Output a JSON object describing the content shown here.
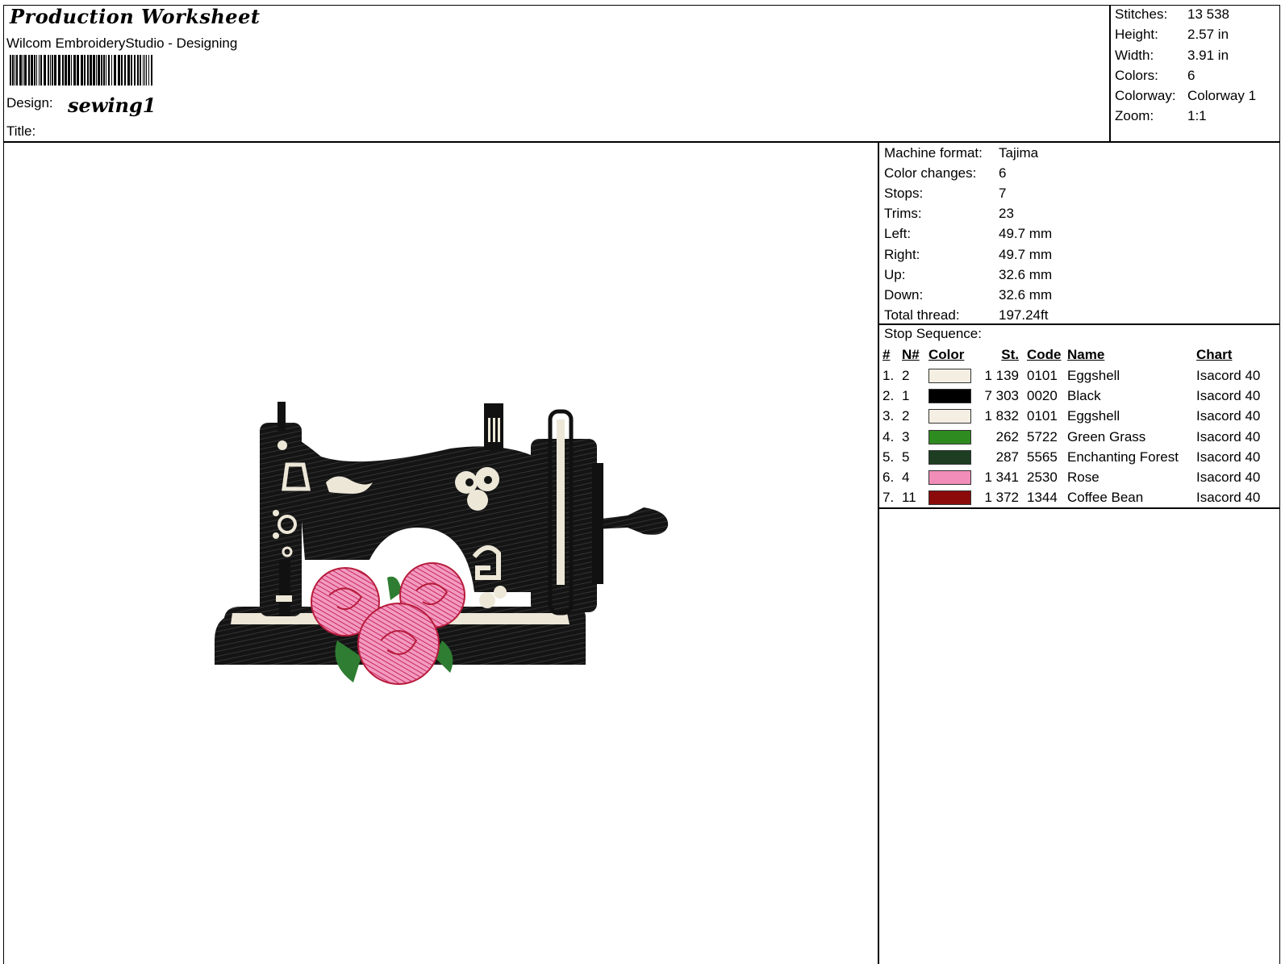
{
  "header": {
    "title": "Production Worksheet",
    "software": "Wilcom EmbroideryStudio - Designing",
    "design_label": "Design:",
    "design_name": "sewing1",
    "title_label": "Title:"
  },
  "stats": [
    {
      "label": "Stitches:",
      "value": "13 538"
    },
    {
      "label": "Height:",
      "value": "2.57 in"
    },
    {
      "label": "Width:",
      "value": "3.91 in"
    },
    {
      "label": "Colors:",
      "value": "6"
    },
    {
      "label": "Colorway:",
      "value": "Colorway 1"
    },
    {
      "label": "Zoom:",
      "value": "1:1"
    }
  ],
  "machine_info": [
    {
      "label": "Machine format:",
      "value": "Tajima"
    },
    {
      "label": "Color changes:",
      "value": "6"
    },
    {
      "label": "Stops:",
      "value": "7"
    },
    {
      "label": "Trims:",
      "value": "23"
    },
    {
      "label": "Left:",
      "value": "49.7 mm"
    },
    {
      "label": "Right:",
      "value": "49.7 mm"
    },
    {
      "label": "Up:",
      "value": "32.6 mm"
    },
    {
      "label": "Down:",
      "value": "32.6 mm"
    },
    {
      "label": "Total thread:",
      "value": "197.24ft"
    }
  ],
  "stop_sequence": {
    "label": "Stop Sequence:",
    "headers": [
      "#",
      "N#",
      "Color",
      "St.",
      "Code",
      "Name",
      "Chart"
    ],
    "rows": [
      {
        "idx": "1.",
        "n": "2",
        "color": "#F4EFE2",
        "st": "1 139",
        "code": "0101",
        "name": "Eggshell",
        "chart": "Isacord 40"
      },
      {
        "idx": "2.",
        "n": "1",
        "color": "#000000",
        "st": "7 303",
        "code": "0020",
        "name": "Black",
        "chart": "Isacord 40"
      },
      {
        "idx": "3.",
        "n": "2",
        "color": "#F4EFE2",
        "st": "1 832",
        "code": "0101",
        "name": "Eggshell",
        "chart": "Isacord 40"
      },
      {
        "idx": "4.",
        "n": "3",
        "color": "#2E8B1F",
        "st": "262",
        "code": "5722",
        "name": "Green Grass",
        "chart": "Isacord 40"
      },
      {
        "idx": "5.",
        "n": "5",
        "color": "#1D3E22",
        "st": "287",
        "code": "5565",
        "name": "Enchanting Forest",
        "chart": "Isacord 40"
      },
      {
        "idx": "6.",
        "n": "4",
        "color": "#F08DB8",
        "st": "1 341",
        "code": "2530",
        "name": "Rose",
        "chart": "Isacord 40"
      },
      {
        "idx": "7.",
        "n": "11",
        "color": "#8B0A0A",
        "st": "1 372",
        "code": "1344",
        "name": "Coffee Bean",
        "chart": "Isacord 40"
      }
    ]
  }
}
